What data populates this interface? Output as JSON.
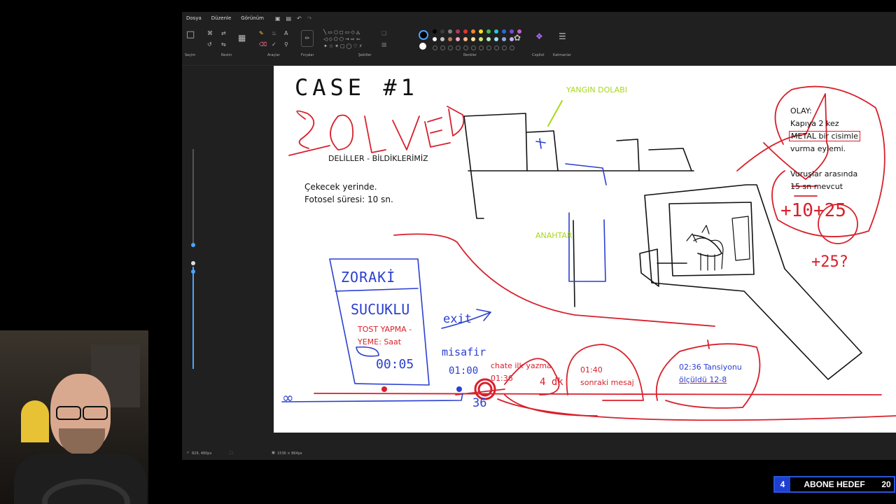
{
  "menu": {
    "file": "Dosya",
    "edit": "Düzenle",
    "view": "Görünüm"
  },
  "ribbon": {
    "groups": {
      "selection": "Seçim",
      "image": "Resim",
      "tools": "Araçlar",
      "brushes": "Fırçalar",
      "shapes": "Şekiller",
      "colors": "Renkler",
      "copilot": "Copilot",
      "layers": "Katmanlar"
    }
  },
  "palette": {
    "row1": [
      "#000000",
      "#3a3a3a",
      "#7f7f7f",
      "#b0356a",
      "#e03434",
      "#f08a2a",
      "#f5e025",
      "#3cbf4a",
      "#29c4d6",
      "#3166d9",
      "#7a4bd6",
      "#c75fc7"
    ],
    "row2": [
      "#ffffff",
      "#c3c3c3",
      "#b57a58",
      "#f3a6c2",
      "#f6b889",
      "#f7e79c",
      "#cde57a",
      "#b3e8c0",
      "#a8dde9",
      "#8fa9e0",
      "#c8b2e8"
    ]
  },
  "canvas": {
    "labels": {
      "case": "CASE #1",
      "solved": "SOLVED",
      "evidence_title": "DELİLLER - BİLDİKLERİMİZ",
      "evidence_1": "Çekecek yerinde.",
      "evidence_2": "Fotosel süresi: 10 sn.",
      "fire_cabinet": "YANGIN DOLABI",
      "key": "ANAHTAR",
      "event_title": "OLAY:",
      "event_1": "Kapıya 2 kez",
      "event_2": "METAL bir cisimle",
      "event_3": "vurma eylemi.",
      "interval_1": "Vuruşlar arasında",
      "interval_2": "15 sn mevcut",
      "sum_1": "+10+25",
      "sum_2": "+25?",
      "forced": "ZORAKİ",
      "sucuklu": "SUCUKLU",
      "toast_1": "TOST YAPMA -",
      "toast_2": "YEME: Saat",
      "toast_time": "00:05",
      "exit": "exit",
      "guest_1": "misafir",
      "guest_2": "01:00",
      "chat_1": "chate ilk yazma",
      "chat_2": "01:36",
      "chat_36": "36",
      "dk": "4 dk",
      "msg_1": "01:40",
      "msg_2": "sonraki mesaj",
      "bp_1": "02:36 Tansiyonu",
      "bp_2": "ölçüldü 12-8",
      "infinity": "∞"
    }
  },
  "status": {
    "cursor": "829, 480px",
    "canvas_size": "1536 × 864px"
  },
  "subscriber_bar": {
    "current": "4",
    "label": "ABONE HEDEF",
    "goal": "20"
  },
  "colors": {
    "marker_red": "#d8202c",
    "marker_blue": "#2b3fd0",
    "marker_green": "#a8d81a",
    "ink_black": "#111111"
  }
}
